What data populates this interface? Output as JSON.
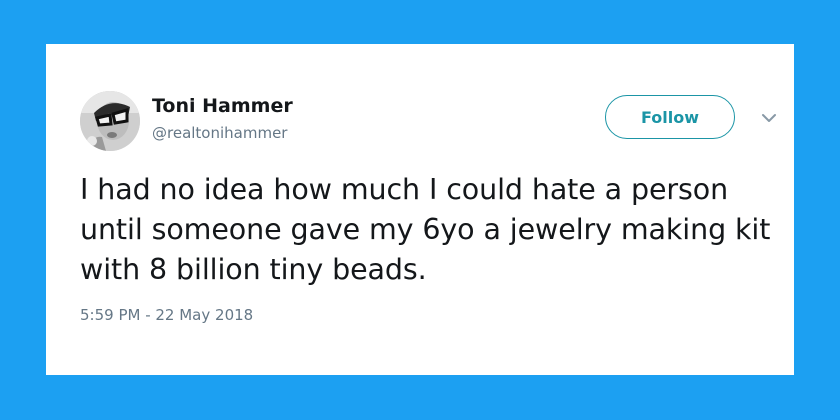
{
  "background_color": "#1ca0f2",
  "accent_color": "#1b95a6",
  "user": {
    "display_name": "Toni Hammer",
    "handle": "@realtonihammer",
    "avatar_icon": "profile-photo-with-cat-eye-glasses"
  },
  "actions": {
    "follow_label": "Follow",
    "more_icon": "chevron-down-icon"
  },
  "tweet": {
    "text": "I had no idea how much I could hate a person until someone gave my 6yo a jewelry making kit with 8 billion tiny beads.",
    "timestamp": "5:59 PM - 22 May 2018"
  }
}
